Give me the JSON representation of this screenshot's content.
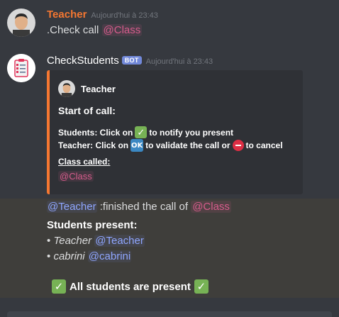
{
  "messages": {
    "teacher": {
      "author": "Teacher",
      "timestamp": "Aujourd'hui à 23:43",
      "text": ".Check call",
      "mention": "@Class",
      "author_color": "#f57731"
    },
    "bot": {
      "author": "CheckStudents",
      "tag": "BOT",
      "timestamp": "Aujourd'hui à 23:43",
      "embed": {
        "author": "Teacher",
        "title": "Start of call:",
        "line1_a": "Students: Click on",
        "line1_b": "to notify you present",
        "line2_a": "Teacher: Click on",
        "line2_ok": "OK",
        "line2_b": "to validate the call or",
        "line2_c": "to cancel",
        "field_title": "Class called:",
        "field_value": "@Class",
        "accent": "#f57731"
      }
    },
    "result": {
      "mention_teacher": "@Teacher",
      "finished_text": ":finished the call of",
      "mention_class": "@Class",
      "present_title": "Students present:",
      "students": [
        {
          "name": "Teacher",
          "mention": "@Teacher"
        },
        {
          "name": "cabrini",
          "mention": "@cabrini"
        }
      ],
      "all_present": "All students are present"
    }
  }
}
